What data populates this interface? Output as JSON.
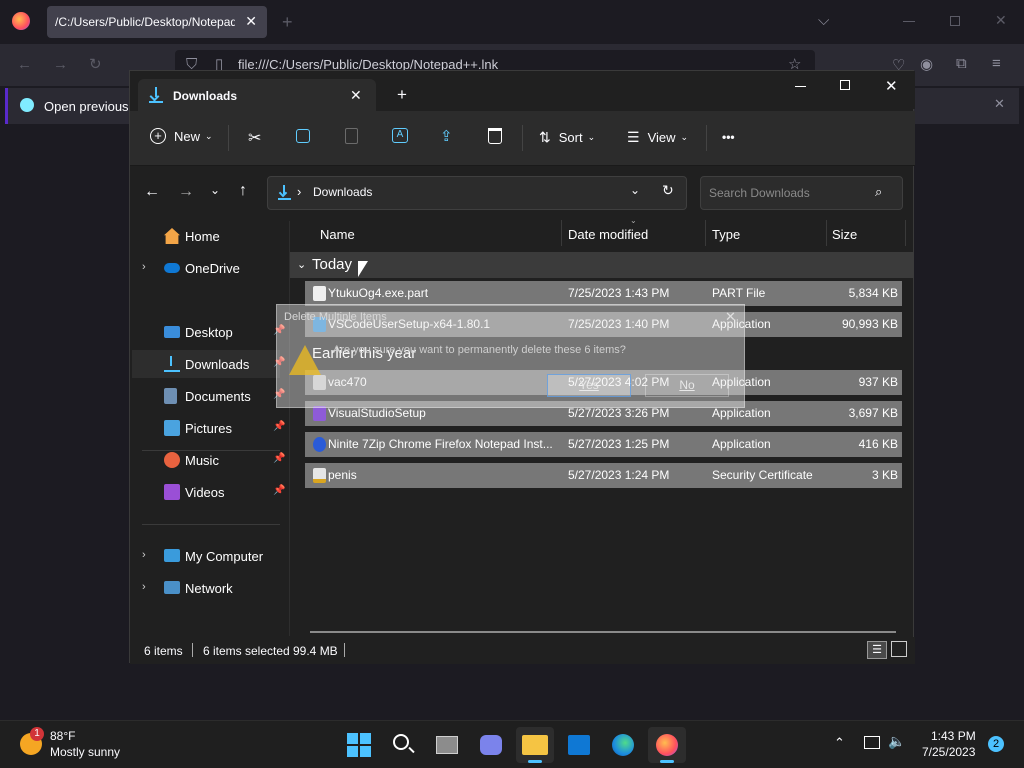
{
  "browser": {
    "tab_title": "/C:/Users/Public/Desktop/Notepad++.lnk",
    "url": "file:///C:/Users/Public/Desktop/Notepad++.lnk",
    "notification": "Open previous t",
    "new_tab": "+"
  },
  "explorer": {
    "tab_title": "Downloads",
    "new_tab": "+",
    "toolbar": {
      "new_label": "New",
      "sort_label": "Sort",
      "view_label": "View",
      "more_label": "•••"
    },
    "breadcrumb_sep": "›",
    "address": "Downloads",
    "search_placeholder": "Search Downloads",
    "nav": {
      "home": "Home",
      "onedrive": "OneDrive",
      "desktop": "Desktop",
      "downloads": "Downloads",
      "documents": "Documents",
      "pictures": "Pictures",
      "music": "Music",
      "videos": "Videos",
      "my_computer": "My Computer",
      "network": "Network"
    },
    "columns": {
      "name": "Name",
      "date": "Date modified",
      "type": "Type",
      "size": "Size"
    },
    "groups": {
      "today": "Today",
      "earlier": "Earlier this year"
    },
    "files": [
      {
        "name": "YtukuOg4.exe.part",
        "date": "7/25/2023 1:43 PM",
        "type": "PART File",
        "size": "5,834 KB",
        "icon": "file-icon"
      },
      {
        "name": "VSCodeUserSetup-x64-1.80.1",
        "date": "7/25/2023 1:40 PM",
        "type": "Application",
        "size": "90,993 KB",
        "icon": "vscode-icon"
      },
      {
        "name": "vac470",
        "date": "5/27/2023 4:02 PM",
        "type": "Application",
        "size": "937 KB",
        "icon": "installer-icon"
      },
      {
        "name": "VisualStudioSetup",
        "date": "5/27/2023 3:26 PM",
        "type": "Application",
        "size": "3,697 KB",
        "icon": "visualstudio-icon"
      },
      {
        "name": "Ninite 7Zip Chrome Firefox Notepad Inst...",
        "date": "5/27/2023 1:25 PM",
        "type": "Application",
        "size": "416 KB",
        "icon": "ninite-icon"
      },
      {
        "name": "penis",
        "date": "5/27/2023 1:24 PM",
        "type": "Security Certificate",
        "size": "3 KB",
        "icon": "certificate-icon"
      }
    ],
    "status": {
      "count": "6 items",
      "selected": "6 items selected",
      "size": "99.4 MB"
    }
  },
  "dialog": {
    "title": "Delete Multiple Items",
    "message": "Are you sure you want to permanently delete these 6 items?",
    "yes": "Yes",
    "no": "No"
  },
  "taskbar": {
    "weather_temp": "88°F",
    "weather_desc": "Mostly sunny",
    "weather_badge": "1",
    "time": "1:43 PM",
    "date": "7/25/2023",
    "notification_count": "2"
  }
}
